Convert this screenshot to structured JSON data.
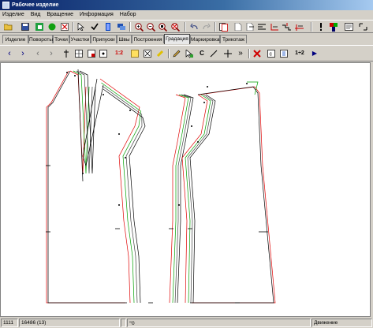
{
  "window": {
    "title": "Рабочее изделие"
  },
  "menu": [
    "Изделие",
    "Вид",
    "Вращение",
    "Информация",
    "Набор"
  ],
  "tabs": [
    {
      "label": "Изделие"
    },
    {
      "label": "Повороты"
    },
    {
      "label": "Точки"
    },
    {
      "label": "Участки"
    },
    {
      "label": "Припуски"
    },
    {
      "label": "Швы"
    },
    {
      "label": "Построения"
    },
    {
      "label": "Градация",
      "active": true
    },
    {
      "label": "Маркировка"
    },
    {
      "label": "Трикотаж"
    }
  ],
  "toolbar2": {
    "scale_label": "1:2",
    "ratio_label": "1÷2",
    "c_label": "C"
  },
  "status": {
    "panel1": "1111",
    "panel2": "16486 (13)",
    "panel3": "",
    "panel4": "0",
    "panel5": "Движение"
  },
  "colors": {
    "base_line": "#000000",
    "size_red": "#e00000",
    "size_green": "#00a000",
    "size_dark": "#404040"
  }
}
